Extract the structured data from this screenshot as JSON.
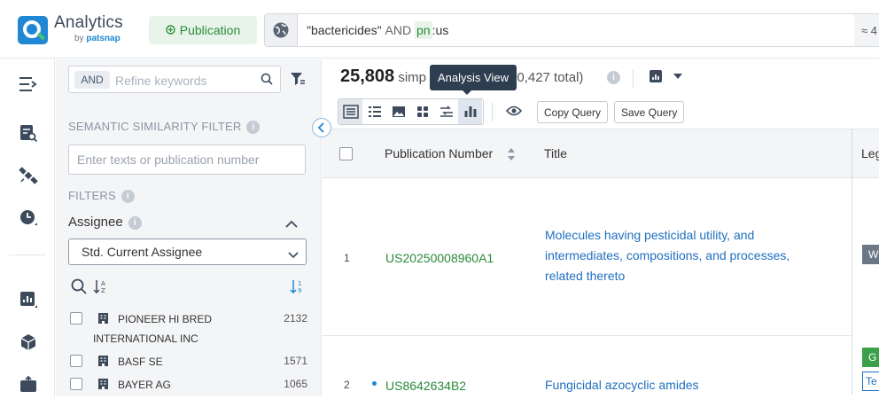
{
  "app": {
    "brand": "Analytics",
    "brand_sub_prefix": "by",
    "brand_sub_name": "patsnap",
    "mode_button": "Publication",
    "query_part1": "\"bactericides\"",
    "query_and": "AND",
    "query_field": "pn",
    "query_part2": ":us",
    "approx": "≈ 4"
  },
  "filters": {
    "and_label": "AND",
    "refine_placeholder": "Refine keywords",
    "semantic_label": "SEMANTIC SIMILARITY FILTER",
    "semantic_placeholder": "Enter texts or publication number",
    "filters_label": "FILTERS",
    "assignee_label": "Assignee",
    "assignee_select": "Std. Current Assignee",
    "assignees": [
      {
        "name_line1": "PIONEER HI BRED",
        "name_line2": "INTERNATIONAL INC",
        "count": "2132"
      },
      {
        "name_line1": "BASF SE",
        "name_line2": "",
        "count": "1571"
      },
      {
        "name_line1": "BAYER AG",
        "name_line2": "",
        "count": "1065"
      }
    ]
  },
  "results": {
    "count": "25,808",
    "count_label": "simp",
    "total_suffix": "40,427 total)",
    "tooltip": "Analysis View",
    "copy_query": "Copy Query",
    "save_query": "Save Query",
    "columns": {
      "pub_number": "Publication Number",
      "title": "Title",
      "legal": "Leg"
    },
    "rows": [
      {
        "num": "1",
        "pub": "US20250008960A1",
        "title": "Molecules having pesticidal utility, and intermediates, compositions, and processes, related thereto",
        "chip": "W",
        "chip_color": "#6b7785"
      },
      {
        "num": "2",
        "pub": "US8642634B2",
        "title": "Fungicidal azocyclic amides",
        "chip": "G",
        "chip_color": "#3aa04a",
        "chip2": "Te"
      }
    ]
  }
}
